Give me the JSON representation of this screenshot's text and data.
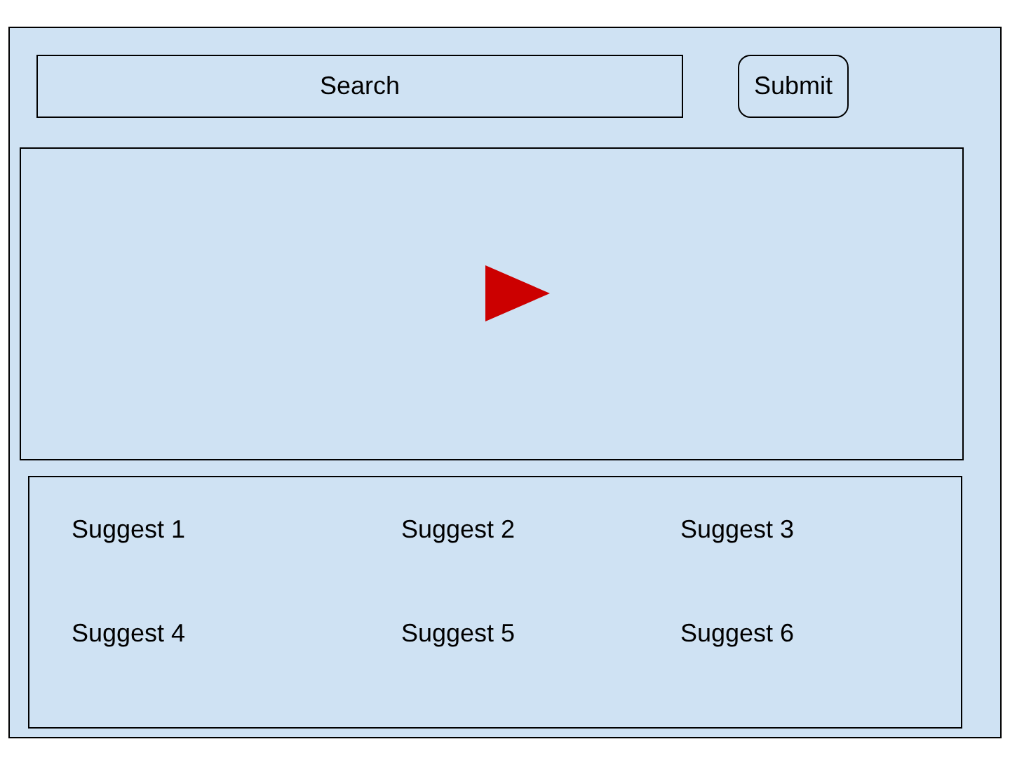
{
  "search": {
    "placeholder": "Search"
  },
  "submit_button": {
    "label": "Submit"
  },
  "video": {
    "kind": "player"
  },
  "suggestions": [
    {
      "label": "Suggest 1"
    },
    {
      "label": "Suggest 2"
    },
    {
      "label": "Suggest 3"
    },
    {
      "label": "Suggest 4"
    },
    {
      "label": "Suggest 5"
    },
    {
      "label": "Suggest 6"
    }
  ]
}
